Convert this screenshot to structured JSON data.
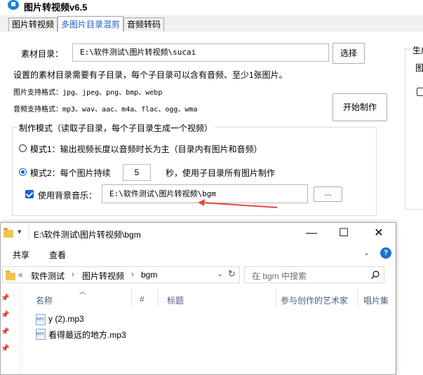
{
  "window": {
    "title": "图片转视频v6.5"
  },
  "tabs": [
    {
      "label": "图片转视频"
    },
    {
      "label": "多图片目录混剪"
    },
    {
      "label": "音频转码"
    }
  ],
  "form": {
    "material_dir_label": "素材目录：",
    "material_dir_value": "E:\\软件测试\\图片转视频\\sucai",
    "browse_label": "选择",
    "hint": "设置的素材目录需要有子目录，每个子目录可以含有音频、至少1张图片。",
    "image_formats": "图片支持格式：jpg、jpeg、png、bmp、webp",
    "audio_formats": "音频支持格式：mp3、wav、aac、m4a、flac、ogg、wma",
    "start_label": "开始制作",
    "mode_group_title": "制作模式（读取子目录，每个子目录生成一个视频）",
    "mode1_label": "模式1：输出视频长度以音频时长为主（目录内有图片和音频）",
    "mode2_prefix": "模式2：每个图片持续",
    "mode2_seconds": "5",
    "mode2_suffix": "秒，使用子目录所有图片制作",
    "selected_mode": "mode2",
    "bgm_checked": true,
    "bgm_label": "使用背景音乐：",
    "bgm_value": "E:\\软件测试\\图片转视频\\bgm",
    "bgm_browse_label": "...",
    "side_group_title": "生成",
    "side_label": "图"
  },
  "explorer": {
    "title": "E:\\软件测试\\图片转视频\\bgm",
    "ribbon": {
      "share": "共享",
      "view": "查看"
    },
    "address": {
      "prefix": "«",
      "crumbs": [
        "软件测试",
        "图片转视频",
        "bgm"
      ]
    },
    "search_placeholder": "在 bgm 中搜索",
    "columns": [
      "名称",
      "#",
      "标题",
      "参与创作的艺术家",
      "唱片集"
    ],
    "files": [
      {
        "name": "y (2).mp3",
        "icon": "mp3-file-icon"
      },
      {
        "name": "看得最远的地方.mp3",
        "icon": "mp3-file-icon"
      }
    ]
  },
  "colors": {
    "accent": "#0a66d8",
    "annotation_arrow": "#e8453c",
    "tab_active_text": "#1d5fbf"
  }
}
